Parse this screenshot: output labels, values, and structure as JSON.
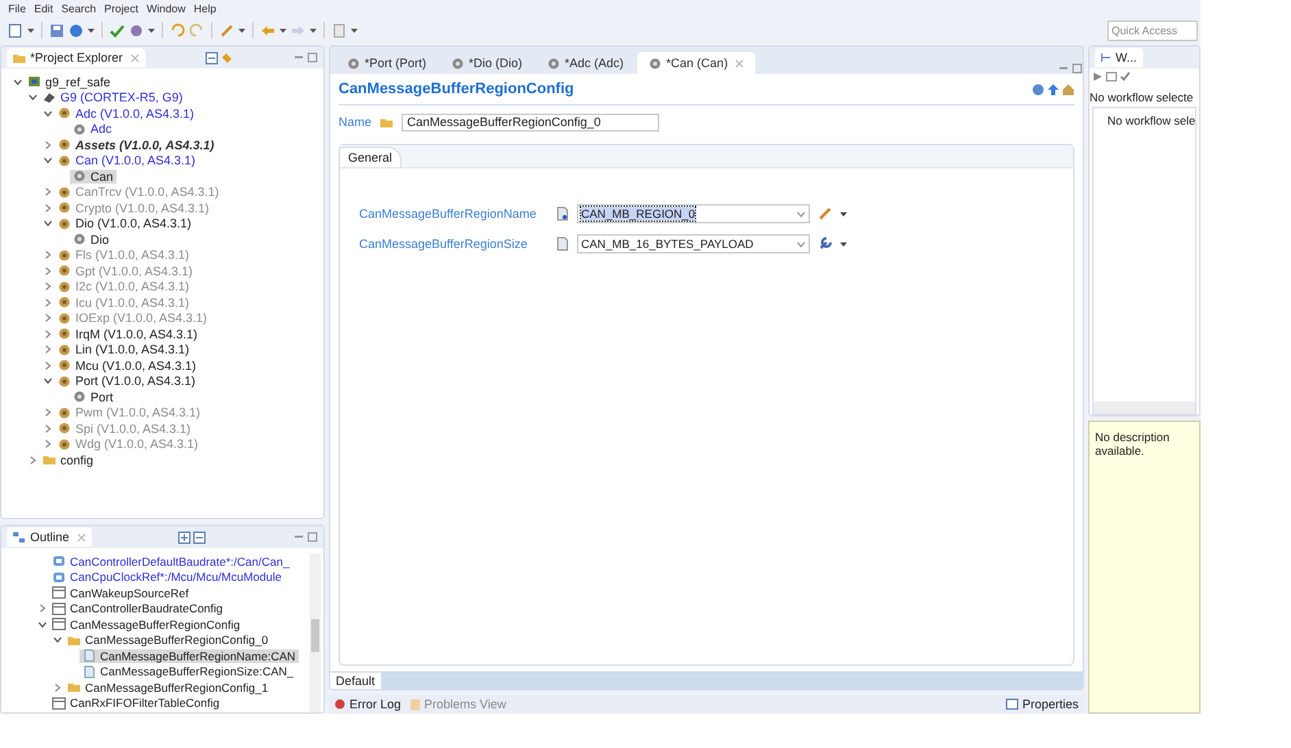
{
  "menu": [
    "File",
    "Edit",
    "Search",
    "Project",
    "Window",
    "Help"
  ],
  "quick_access": {
    "placeholder": "Quick Access"
  },
  "project_explorer": {
    "title": "*Project Explorer",
    "tree": [
      {
        "label": "g9_ref_safe",
        "kind": "project",
        "expanded": true,
        "selected": false,
        "children": [
          {
            "label": "G9 (CORTEX-R5, G9)",
            "kind": "ecu",
            "color": "#2f2fd8",
            "expanded": true,
            "selected": false,
            "children": [
              {
                "label": "Adc (V1.0.0, AS4.3.1)",
                "kind": "module",
                "color": "#2f2fd8",
                "expanded": true,
                "selected": false,
                "children": [
                  {
                    "label": "Adc",
                    "kind": "instance",
                    "color": "#2f2fd8",
                    "selected": false
                  }
                ]
              },
              {
                "label": "Assets (V1.0.0, AS4.3.1)",
                "kind": "module",
                "color": "#333333",
                "italic": true,
                "expanded": false,
                "selected": false
              },
              {
                "label": "Can (V1.0.0, AS4.3.1)",
                "kind": "module",
                "color": "#2f2fd8",
                "expanded": true,
                "selected": false,
                "children": [
                  {
                    "label": "Can",
                    "kind": "instance",
                    "color": "#222222",
                    "selected": true
                  }
                ]
              },
              {
                "label": "CanTrcv (V1.0.0, AS4.3.1)",
                "kind": "module",
                "color": "#8c8c8c",
                "expanded": false,
                "selected": false
              },
              {
                "label": "Crypto (V1.0.0, AS4.3.1)",
                "kind": "module",
                "color": "#8c8c8c",
                "expanded": false,
                "selected": false
              },
              {
                "label": "Dio (V1.0.0, AS4.3.1)",
                "kind": "module",
                "color": "#222222",
                "expanded": true,
                "selected": false,
                "children": [
                  {
                    "label": "Dio",
                    "kind": "instance",
                    "color": "#222222",
                    "selected": false
                  }
                ]
              },
              {
                "label": "Fls (V1.0.0, AS4.3.1)",
                "kind": "module",
                "color": "#8c8c8c",
                "expanded": false,
                "selected": false
              },
              {
                "label": "Gpt (V1.0.0, AS4.3.1)",
                "kind": "module",
                "color": "#8c8c8c",
                "expanded": false,
                "selected": false
              },
              {
                "label": "I2c (V1.0.0, AS4.3.1)",
                "kind": "module",
                "color": "#8c8c8c",
                "expanded": false,
                "selected": false
              },
              {
                "label": "Icu (V1.0.0, AS4.3.1)",
                "kind": "module",
                "color": "#8c8c8c",
                "expanded": false,
                "selected": false
              },
              {
                "label": "IOExp (V1.0.0, AS4.3.1)",
                "kind": "module",
                "color": "#8c8c8c",
                "expanded": false,
                "selected": false
              },
              {
                "label": "IrqM (V1.0.0, AS4.3.1)",
                "kind": "module",
                "color": "#222222",
                "expanded": false,
                "selected": false
              },
              {
                "label": "Lin (V1.0.0, AS4.3.1)",
                "kind": "module",
                "color": "#222222",
                "expanded": false,
                "selected": false
              },
              {
                "label": "Mcu (V1.0.0, AS4.3.1)",
                "kind": "module",
                "color": "#222222",
                "expanded": false,
                "selected": false
              },
              {
                "label": "Port (V1.0.0, AS4.3.1)",
                "kind": "module",
                "color": "#222222",
                "expanded": true,
                "selected": false,
                "children": [
                  {
                    "label": "Port",
                    "kind": "instance",
                    "color": "#222222",
                    "selected": false
                  }
                ]
              },
              {
                "label": "Pwm (V1.0.0, AS4.3.1)",
                "kind": "module",
                "color": "#8c8c8c",
                "expanded": false,
                "selected": false
              },
              {
                "label": "Spi (V1.0.0, AS4.3.1)",
                "kind": "module",
                "color": "#8c8c8c",
                "expanded": false,
                "selected": false
              },
              {
                "label": "Wdg (V1.0.0, AS4.3.1)",
                "kind": "module",
                "color": "#8c8c8c",
                "expanded": false,
                "selected": false
              }
            ]
          },
          {
            "label": "config",
            "kind": "folder",
            "color": "#222222",
            "expanded": false,
            "selected": false
          }
        ]
      }
    ]
  },
  "outline": {
    "title": "Outline",
    "tree": [
      {
        "label": "CanControllerDefaultBaudrate*:/Can/Can_",
        "kind": "reference",
        "color": "#2f2fd8",
        "selected": false
      },
      {
        "label": "CanCpuClockRef*:/Mcu/Mcu/McuModule",
        "kind": "reference",
        "color": "#2f2fd8",
        "selected": false
      },
      {
        "label": "CanWakeupSourceRef",
        "kind": "container",
        "color": "#222222",
        "selected": false
      },
      {
        "label": "CanControllerBaudrateConfig",
        "kind": "container",
        "color": "#222222",
        "expanded": false,
        "selected": false
      },
      {
        "label": "CanMessageBufferRegionConfig",
        "kind": "container",
        "color": "#222222",
        "expanded": true,
        "selected": false,
        "children": [
          {
            "label": "CanMessageBufferRegionConfig_0",
            "kind": "folder",
            "color": "#222222",
            "expanded": true,
            "selected": false,
            "children": [
              {
                "label": "CanMessageBufferRegionName:CAN",
                "kind": "parameter",
                "color": "#222222",
                "selected": true
              },
              {
                "label": "CanMessageBufferRegionSize:CAN_",
                "kind": "parameter",
                "color": "#222222",
                "selected": false
              }
            ]
          },
          {
            "label": "CanMessageBufferRegionConfig_1",
            "kind": "folder",
            "color": "#222222",
            "expanded": false,
            "selected": false
          }
        ]
      },
      {
        "label": "CanRxFIFOFilterTableConfig",
        "kind": "container",
        "color": "#222222",
        "selected": false
      }
    ]
  },
  "editor": {
    "tabs": [
      {
        "label": "*Port (Port)",
        "selected": false
      },
      {
        "label": "*Dio (Dio)",
        "selected": false
      },
      {
        "label": "*Adc (Adc)",
        "selected": false
      },
      {
        "label": "*Can (Can)",
        "selected": true
      }
    ],
    "title": "CanMessageBufferRegionConfig",
    "name_label": "Name",
    "name_value": "CanMessageBufferRegionConfig_0",
    "section_tab": "General",
    "parameters": [
      {
        "label": "CanMessageBufferRegionName",
        "value": "CAN_MB_REGION_0",
        "selected": true,
        "kind": "text"
      },
      {
        "label": "CanMessageBufferRegionSize",
        "value": "CAN_MB_16_BYTES_PAYLOAD",
        "selected": false,
        "kind": "enum"
      }
    ],
    "bottom_tab": "Default"
  },
  "workflow": {
    "title": "W...",
    "status": "No workflow selecte",
    "message": "No workflow sele",
    "description": "No description available."
  },
  "bottom_panels": {
    "tabs": [
      {
        "label": "Error Log",
        "selected": true
      },
      {
        "label": "Problems View",
        "selected": false
      }
    ],
    "properties": "Properties"
  }
}
